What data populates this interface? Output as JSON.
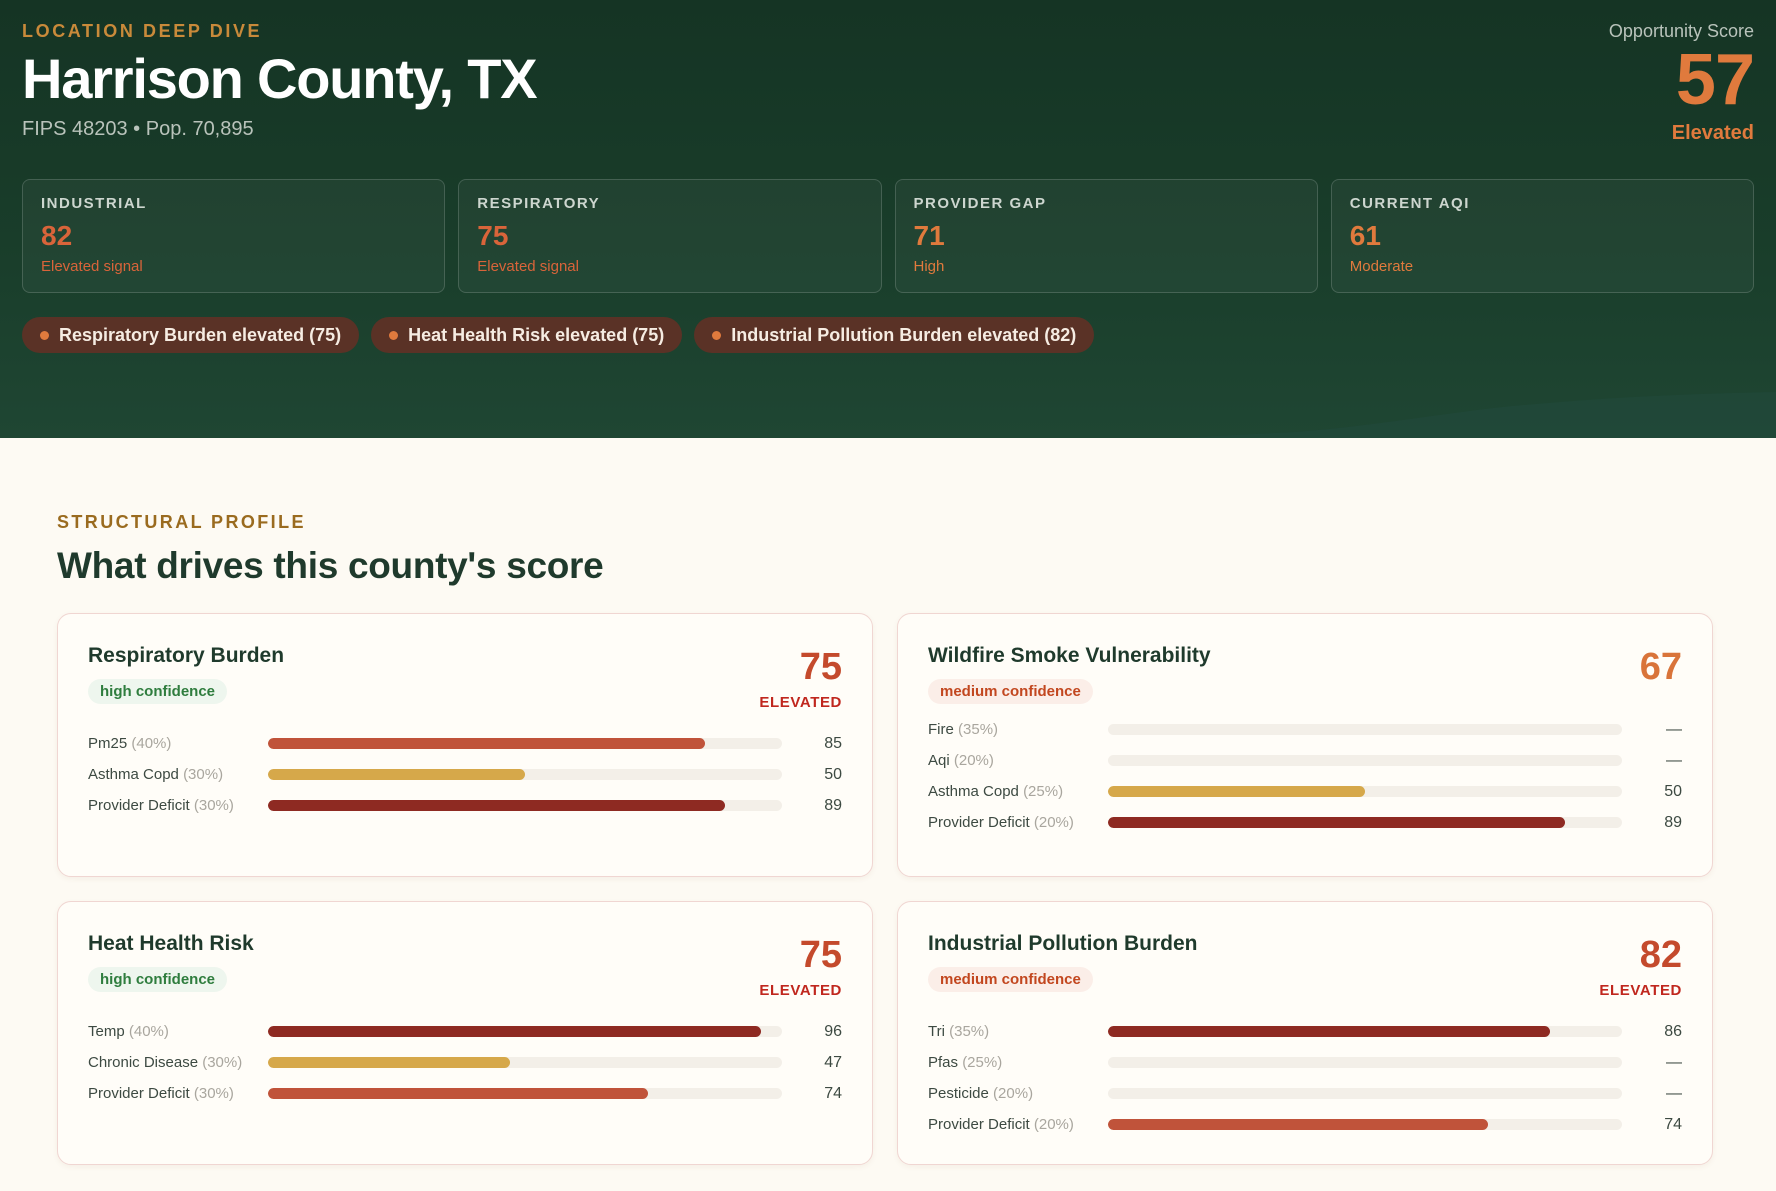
{
  "hero": {
    "eyebrow": "LOCATION DEEP DIVE",
    "title": "Harrison County, TX",
    "meta": "FIPS 48203 • Pop. 70,895",
    "opportunity": {
      "label": "Opportunity Score",
      "score": "57",
      "level": "Elevated"
    },
    "metrics": [
      {
        "label": "INDUSTRIAL",
        "value": "82",
        "sub": "Elevated signal",
        "color": "#d9643a"
      },
      {
        "label": "RESPIRATORY",
        "value": "75",
        "sub": "Elevated signal",
        "color": "#d9643a"
      },
      {
        "label": "PROVIDER GAP",
        "value": "71",
        "sub": "High",
        "color": "#e07a3d"
      },
      {
        "label": "CURRENT AQI",
        "value": "61",
        "sub": "Moderate",
        "color": "#e07a3d"
      }
    ],
    "chips": [
      "Respiratory Burden elevated (75)",
      "Heat Health Risk elevated (75)",
      "Industrial Pollution Burden elevated (82)"
    ]
  },
  "section": {
    "eyebrow": "STRUCTURAL PROFILE",
    "title": "What drives this county's score"
  },
  "cards": [
    {
      "title": "Respiratory Burden",
      "confidence": "high confidence",
      "confidence_level": "high",
      "score": "75",
      "level": "ELEVATED",
      "score_color": "#c44a2c",
      "rows": [
        {
          "label": "Pm25",
          "weight": "(40%)",
          "value": "85",
          "fill": 0.85,
          "color": "#c0533a"
        },
        {
          "label": "Asthma Copd",
          "weight": "(30%)",
          "value": "50",
          "fill": 0.5,
          "color": "#d6a84a"
        },
        {
          "label": "Provider Deficit",
          "weight": "(30%)",
          "value": "89",
          "fill": 0.89,
          "color": "#8e2a22"
        }
      ]
    },
    {
      "title": "Wildfire Smoke Vulnerability",
      "confidence": "medium confidence",
      "confidence_level": "medium",
      "score": "67",
      "level": "",
      "score_color": "#d9743a",
      "rows": [
        {
          "label": "Fire",
          "weight": "(35%)",
          "value": "—",
          "fill": 0,
          "color": "#c0533a"
        },
        {
          "label": "Aqi",
          "weight": "(20%)",
          "value": "—",
          "fill": 0,
          "color": "#c0533a"
        },
        {
          "label": "Asthma Copd",
          "weight": "(25%)",
          "value": "50",
          "fill": 0.5,
          "color": "#d6a84a"
        },
        {
          "label": "Provider Deficit",
          "weight": "(20%)",
          "value": "89",
          "fill": 0.89,
          "color": "#8e2a22"
        }
      ]
    },
    {
      "title": "Heat Health Risk",
      "confidence": "high confidence",
      "confidence_level": "high",
      "score": "75",
      "level": "ELEVATED",
      "score_color": "#c44a2c",
      "rows": [
        {
          "label": "Temp",
          "weight": "(40%)",
          "value": "96",
          "fill": 0.96,
          "color": "#8e2a22"
        },
        {
          "label": "Chronic Disease",
          "weight": "(30%)",
          "value": "47",
          "fill": 0.47,
          "color": "#d6a84a"
        },
        {
          "label": "Provider Deficit",
          "weight": "(30%)",
          "value": "74",
          "fill": 0.74,
          "color": "#c0533a"
        }
      ]
    },
    {
      "title": "Industrial Pollution Burden",
      "confidence": "medium confidence",
      "confidence_level": "medium",
      "score": "82",
      "level": "ELEVATED",
      "score_color": "#c44a2c",
      "rows": [
        {
          "label": "Tri",
          "weight": "(35%)",
          "value": "86",
          "fill": 0.86,
          "color": "#8e2a22"
        },
        {
          "label": "Pfas",
          "weight": "(25%)",
          "value": "—",
          "fill": 0,
          "color": "#c0533a"
        },
        {
          "label": "Pesticide",
          "weight": "(20%)",
          "value": "—",
          "fill": 0,
          "color": "#c0533a"
        },
        {
          "label": "Provider Deficit",
          "weight": "(20%)",
          "value": "74",
          "fill": 0.74,
          "color": "#c0533a"
        }
      ]
    }
  ]
}
